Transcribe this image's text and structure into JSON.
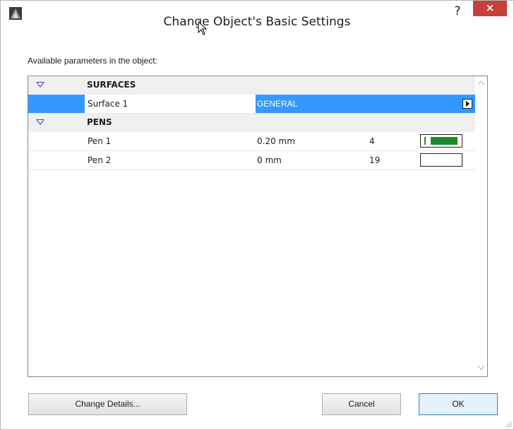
{
  "window": {
    "title": "Change Object's Basic Settings",
    "help": "?",
    "close": "×"
  },
  "main": {
    "available_label": "Available parameters in the object:"
  },
  "list": {
    "groups": [
      {
        "name": "SURFACES"
      },
      {
        "name": "PENS"
      }
    ],
    "surfaces": [
      {
        "name": "Surface 1",
        "value": "GENERAL"
      }
    ],
    "pens": [
      {
        "name": "Pen 1",
        "value": "0.20 mm",
        "number": "4"
      },
      {
        "name": "Pen 2",
        "value": "0 mm",
        "number": "19"
      }
    ]
  },
  "buttons": {
    "change_details": "Change Details...",
    "cancel": "Cancel",
    "ok": "OK"
  },
  "colors": {
    "selection": "#3399ff",
    "pen1": "#1c8a2a",
    "close": "#c7403a"
  }
}
